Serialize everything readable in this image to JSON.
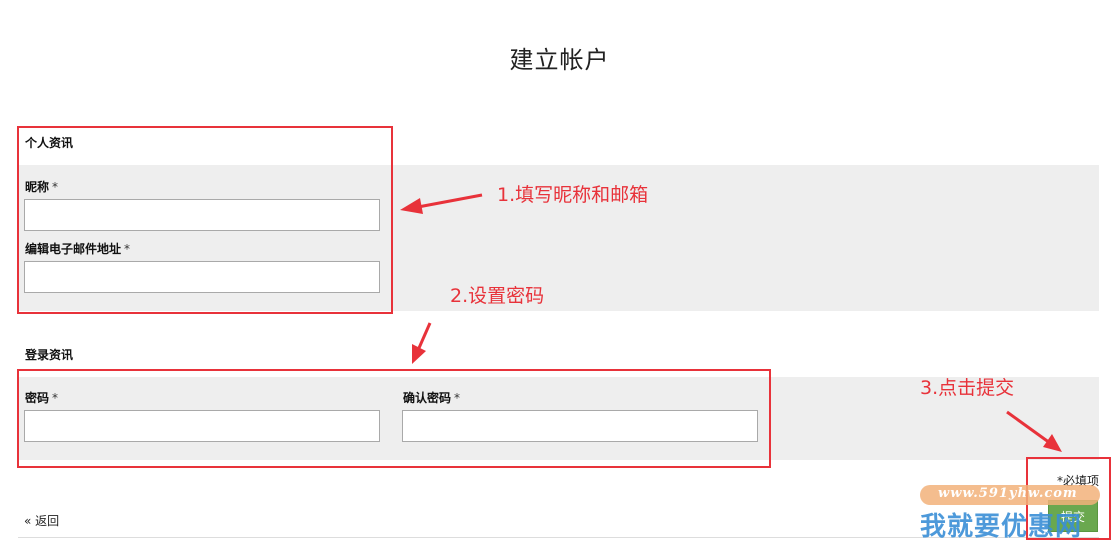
{
  "page": {
    "title": "建立帐户"
  },
  "personal": {
    "section_label": "个人资讯",
    "nickname_label": "昵称",
    "nickname_value": "",
    "email_label": "编辑电子邮件地址",
    "email_value": ""
  },
  "login": {
    "section_label": "登录资讯",
    "password_label": "密码",
    "password_value": "",
    "confirm_label": "确认密码",
    "confirm_value": ""
  },
  "required_marker": "*",
  "footer": {
    "required_note": "*必填项",
    "back_label": "« 返回",
    "submit_label": "提交"
  },
  "annotations": {
    "step1": "1.填写昵称和邮箱",
    "step2": "2.设置密码",
    "step3": "3.点击提交",
    "color": "#e8323a"
  },
  "watermark": {
    "url": "www.591yhw.com",
    "text": "我就要优惠网"
  },
  "colors": {
    "band": "#eeeeee",
    "annotation": "#e8323a",
    "submit": "#6aa84f"
  }
}
